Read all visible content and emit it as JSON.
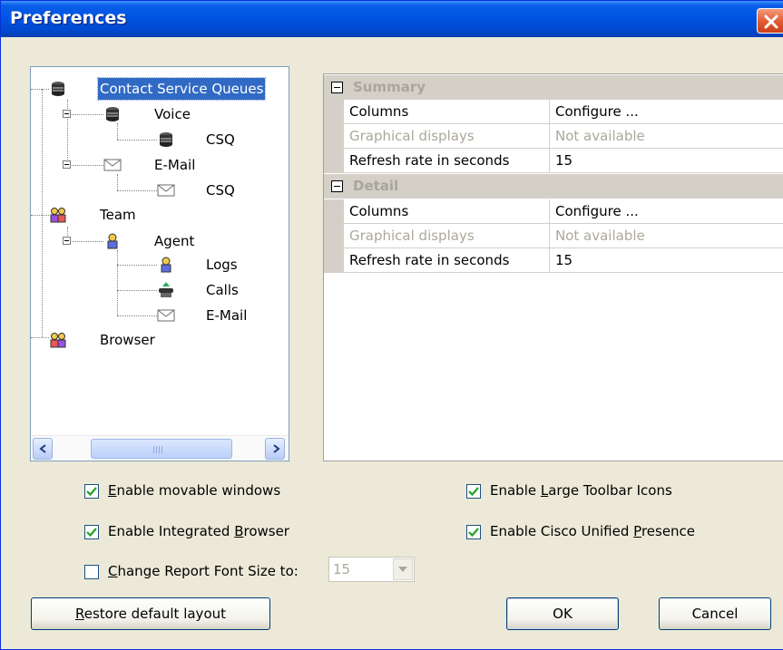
{
  "window": {
    "title": "Preferences"
  },
  "tree": {
    "nodes": [
      {
        "label": "Contact Service Queues",
        "icon": "queue-icon"
      },
      {
        "label": "Voice",
        "icon": "queue-icon"
      },
      {
        "label": "CSQ",
        "icon": "queue-icon"
      },
      {
        "label": "E-Mail",
        "icon": "envelope-icon"
      },
      {
        "label": "CSQ",
        "icon": "envelope-icon"
      },
      {
        "label": "Team",
        "icon": "team-icon"
      },
      {
        "label": "Agent",
        "icon": "agent-icon"
      },
      {
        "label": "Logs",
        "icon": "agent-icon"
      },
      {
        "label": "Calls",
        "icon": "phone-calls-icon"
      },
      {
        "label": "E-Mail",
        "icon": "envelope-icon"
      },
      {
        "label": "Browser",
        "icon": "team-icon"
      }
    ],
    "selected": "Contact Service Queues"
  },
  "grid": {
    "summary": {
      "title": "Summary",
      "rows": [
        {
          "name": "Columns",
          "value": "Configure ..."
        },
        {
          "name": "Graphical displays",
          "value": "Not available"
        },
        {
          "name": "Refresh rate in seconds",
          "value": "15"
        }
      ]
    },
    "detail": {
      "title": "Detail",
      "rows": [
        {
          "name": "Columns",
          "value": "Configure ..."
        },
        {
          "name": "Graphical displays",
          "value": "Not available"
        },
        {
          "name": "Refresh rate in seconds",
          "value": "15"
        }
      ]
    }
  },
  "options": {
    "movable": {
      "pre": "",
      "key": "E",
      "post": "nable movable windows",
      "checked": true
    },
    "browser": {
      "pre": "Enable Integrated ",
      "key": "B",
      "post": "rowser",
      "checked": true
    },
    "font": {
      "pre": "",
      "key": "C",
      "post": "hange Report Font Size to:",
      "checked": false
    },
    "large_icons": {
      "pre": "Enable ",
      "key": "L",
      "post": "arge Toolbar Icons",
      "checked": true
    },
    "presence": {
      "pre": "Enable Cisco Unified ",
      "key": "P",
      "post": "resence",
      "checked": true
    }
  },
  "font_size": {
    "value": "15"
  },
  "buttons": {
    "restore": {
      "key": "R",
      "post": "estore default layout"
    },
    "ok": "OK",
    "cancel": "Cancel"
  }
}
